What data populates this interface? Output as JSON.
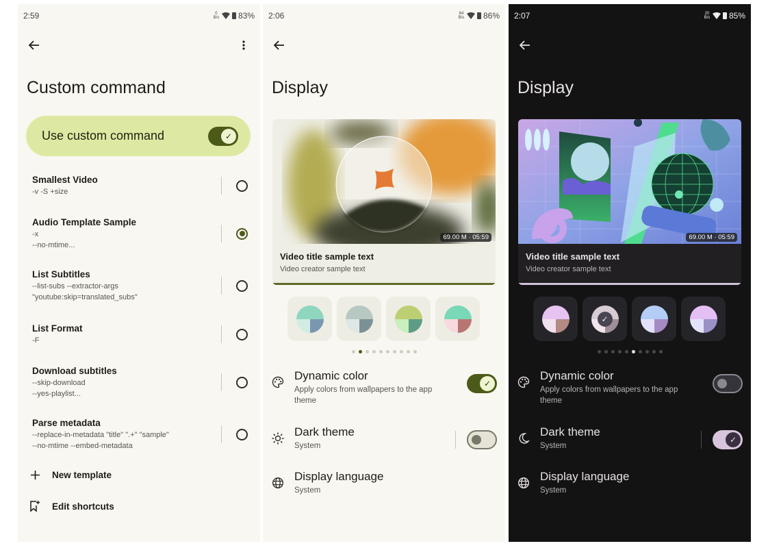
{
  "panels": {
    "custom_command": {
      "status": {
        "time": "2:59",
        "net_top": "0",
        "net_bottom": "B/s",
        "battery": "83%"
      },
      "title": "Custom command",
      "use_custom": {
        "label": "Use custom command",
        "checked": true
      },
      "templates": [
        {
          "title": "Smallest Video",
          "lines": [
            "-v -S +size"
          ],
          "selected": false
        },
        {
          "title": "Audio Template Sample",
          "lines": [
            "-x",
            "--no-mtime..."
          ],
          "selected": true
        },
        {
          "title": "List Subtitles",
          "lines": [
            "--list-subs --extractor-args",
            "\"youtube:skip=translated_subs\""
          ],
          "selected": false
        },
        {
          "title": "List Format",
          "lines": [
            "-F"
          ],
          "selected": false
        },
        {
          "title": "Download subtitles",
          "lines": [
            "--skip-download",
            "--yes-playlist..."
          ],
          "selected": false
        },
        {
          "title": "Parse metadata",
          "lines": [
            "--replace-in-metadata \"title\" \".+\" \"sample\"",
            "--no-mtime --embed-metadata"
          ],
          "selected": false
        }
      ],
      "actions": {
        "new_template": "New template",
        "edit_shortcuts": "Edit shortcuts"
      }
    },
    "display_light": {
      "status": {
        "time": "2:06",
        "net_top": "64",
        "net_bottom": "B/s",
        "battery": "86%"
      },
      "title": "Display",
      "video": {
        "title": "Video title sample text",
        "creator": "Video creator sample text",
        "meta": "69.00 M · 05:59"
      },
      "palettes": [
        {
          "top": "#8fd6bf",
          "bl": "#d3ece3",
          "br": "#7b97b0",
          "selected": false
        },
        {
          "top": "#b7c8c3",
          "bl": "#dfe7e4",
          "br": "#7c9196",
          "selected": false
        },
        {
          "top": "#bccf73",
          "bl": "#c8efbd",
          "br": "#5e9c85",
          "selected": false
        },
        {
          "top": "#78d8b7",
          "bl": "#f7d9de",
          "br": "#b87672",
          "selected": false
        }
      ],
      "page_count": 10,
      "active_page": 1,
      "settings": {
        "dynamic_color": {
          "title": "Dynamic color",
          "sub": "Apply colors from wallpapers to the app theme",
          "checked": true
        },
        "dark_theme": {
          "title": "Dark theme",
          "sub": "System",
          "checked": false
        },
        "language": {
          "title": "Display language",
          "sub": "System"
        }
      }
    },
    "display_dark": {
      "status": {
        "time": "2:07",
        "net_top": "20",
        "net_bottom": "B/s",
        "battery": "85%"
      },
      "title": "Display",
      "video": {
        "title": "Video title sample text",
        "creator": "Video creator sample text",
        "meta": "69.00 M · 05:59"
      },
      "palettes": [
        {
          "top": "#e6c3f0",
          "bl": "#f1e1ef",
          "br": "#b48a84",
          "selected": false
        },
        {
          "top": "#d8ccd4",
          "bl": "#efe5ea",
          "br": "#a08f98",
          "selected": true
        },
        {
          "top": "#b3cdf7",
          "bl": "#e3e2fb",
          "br": "#a58bc4",
          "selected": false
        },
        {
          "top": "#e4bff4",
          "bl": "#e3e4fb",
          "br": "#9a91c7",
          "selected": false
        }
      ],
      "page_count": 10,
      "active_page": 5,
      "settings": {
        "dynamic_color": {
          "title": "Dynamic color",
          "sub": "Apply colors from wallpapers to the app theme",
          "checked": false
        },
        "dark_theme": {
          "title": "Dark theme",
          "sub": "System",
          "checked": true
        },
        "language": {
          "title": "Display language",
          "sub": "System"
        }
      }
    }
  },
  "colors": {
    "light_bg": "#f9f7f2",
    "dark_bg": "#141313",
    "accent_light": "#4b5a19",
    "accent_card": "#dde9a2",
    "accent_dark": "#d9c4dd"
  }
}
